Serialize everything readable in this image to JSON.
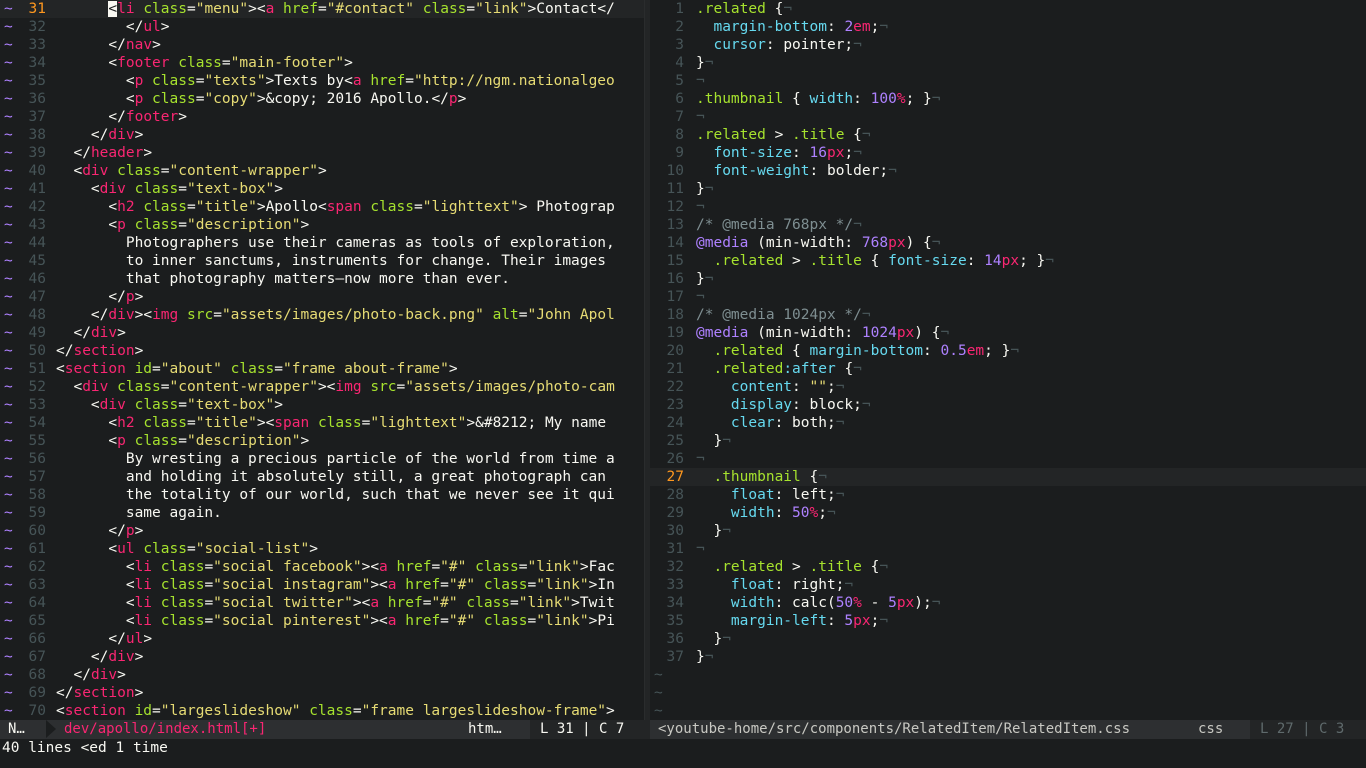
{
  "left_pane": {
    "lines": [
      {
        "n": "31",
        "t": "      <li class=\"menu\"><a href=\"#contact\" class=\"link\">Contact</"
      },
      {
        "n": "32",
        "t": "        </ul>"
      },
      {
        "n": "33",
        "t": "      </nav>"
      },
      {
        "n": "34",
        "t": "      <footer class=\"main-footer\">"
      },
      {
        "n": "35",
        "t": "        <p class=\"texts\">Texts by<a href=\"http://ngm.nationalgeo"
      },
      {
        "n": "36",
        "t": "        <p class=\"copy\">&copy; 2016 Apollo.</p>"
      },
      {
        "n": "37",
        "t": "      </footer>"
      },
      {
        "n": "38",
        "t": "    </div>"
      },
      {
        "n": "39",
        "t": "  </header>"
      },
      {
        "n": "40",
        "t": "  <div class=\"content-wrapper\">"
      },
      {
        "n": "41",
        "t": "    <div class=\"text-box\">"
      },
      {
        "n": "42",
        "t": "      <h2 class=\"title\">Apollo<span class=\"lighttext\"> Photograp"
      },
      {
        "n": "43",
        "t": "      <p class=\"description\">"
      },
      {
        "n": "44",
        "t": "        Photographers use their cameras as tools of exploration,"
      },
      {
        "n": "45",
        "t": "        to inner sanctums, instruments for change. Their images"
      },
      {
        "n": "46",
        "t": "        that photography matters—now more than ever."
      },
      {
        "n": "47",
        "t": "      </p>"
      },
      {
        "n": "48",
        "t": "    </div><img src=\"assets/images/photo-back.png\" alt=\"John Apol"
      },
      {
        "n": "49",
        "t": "  </div>"
      },
      {
        "n": "50",
        "t": "</section>"
      },
      {
        "n": "51",
        "t": "<section id=\"about\" class=\"frame about-frame\">"
      },
      {
        "n": "52",
        "t": "  <div class=\"content-wrapper\"><img src=\"assets/images/photo-cam"
      },
      {
        "n": "53",
        "t": "    <div class=\"text-box\">"
      },
      {
        "n": "54",
        "t": "      <h2 class=\"title\"><span class=\"lighttext\">&#8212; My name"
      },
      {
        "n": "55",
        "t": "      <p class=\"description\">"
      },
      {
        "n": "56",
        "t": "        By wresting a precious particle of the world from time a"
      },
      {
        "n": "57",
        "t": "        and holding it absolutely still, a great photograph can"
      },
      {
        "n": "58",
        "t": "        the totality of our world, such that we never see it qui"
      },
      {
        "n": "59",
        "t": "        same again."
      },
      {
        "n": "60",
        "t": "      </p>"
      },
      {
        "n": "61",
        "t": "      <ul class=\"social-list\">"
      },
      {
        "n": "62",
        "t": "        <li class=\"social facebook\"><a href=\"#\" class=\"link\">Fac"
      },
      {
        "n": "63",
        "t": "        <li class=\"social instagram\"><a href=\"#\" class=\"link\">In"
      },
      {
        "n": "64",
        "t": "        <li class=\"social twitter\"><a href=\"#\" class=\"link\">Twit"
      },
      {
        "n": "65",
        "t": "        <li class=\"social pinterest\"><a href=\"#\" class=\"link\">Pi"
      },
      {
        "n": "66",
        "t": "      </ul>"
      },
      {
        "n": "67",
        "t": "    </div>"
      },
      {
        "n": "68",
        "t": "  </div>"
      },
      {
        "n": "69",
        "t": "</section>"
      },
      {
        "n": "70",
        "t": "<section id=\"largeslideshow\" class=\"frame largeslideshow-frame\">"
      }
    ]
  },
  "right_pane": {
    "lines": [
      {
        "n": "1",
        "t": ".related {¬"
      },
      {
        "n": "2",
        "t": "  margin-bottom: 2em;¬"
      },
      {
        "n": "3",
        "t": "  cursor: pointer;¬"
      },
      {
        "n": "4",
        "t": "}¬"
      },
      {
        "n": "5",
        "t": "¬"
      },
      {
        "n": "6",
        "t": ".thumbnail { width: 100%; }¬"
      },
      {
        "n": "7",
        "t": "¬"
      },
      {
        "n": "8",
        "t": ".related > .title {¬"
      },
      {
        "n": "9",
        "t": "  font-size: 16px;¬"
      },
      {
        "n": "10",
        "t": "  font-weight: bolder;¬"
      },
      {
        "n": "11",
        "t": "}¬"
      },
      {
        "n": "12",
        "t": "¬"
      },
      {
        "n": "13",
        "t": "/* @media 768px */¬"
      },
      {
        "n": "14",
        "t": "@media (min-width: 768px) {¬"
      },
      {
        "n": "15",
        "t": "  .related > .title { font-size: 14px; }¬"
      },
      {
        "n": "16",
        "t": "}¬"
      },
      {
        "n": "17",
        "t": "¬"
      },
      {
        "n": "18",
        "t": "/* @media 1024px */¬"
      },
      {
        "n": "19",
        "t": "@media (min-width: 1024px) {¬"
      },
      {
        "n": "20",
        "t": "  .related { margin-bottom: 0.5em; }¬"
      },
      {
        "n": "21",
        "t": "  .related:after {¬"
      },
      {
        "n": "22",
        "t": "    content: \"\";¬"
      },
      {
        "n": "23",
        "t": "    display: block;¬"
      },
      {
        "n": "24",
        "t": "    clear: both;¬"
      },
      {
        "n": "25",
        "t": "  }¬"
      },
      {
        "n": "26",
        "t": "¬"
      },
      {
        "n": "27",
        "t": "  .thumbnail {¬"
      },
      {
        "n": "28",
        "t": "    float: left;¬"
      },
      {
        "n": "29",
        "t": "    width: 50%;¬"
      },
      {
        "n": "30",
        "t": "  }¬"
      },
      {
        "n": "31",
        "t": "¬"
      },
      {
        "n": "32",
        "t": "  .related > .title {¬"
      },
      {
        "n": "33",
        "t": "    float: right;¬"
      },
      {
        "n": "34",
        "t": "    width: calc(50% - 5px);¬"
      },
      {
        "n": "35",
        "t": "    margin-left: 5px;¬"
      },
      {
        "n": "36",
        "t": "  }¬"
      },
      {
        "n": "37",
        "t": "}¬"
      }
    ],
    "empty_markers": [
      "~",
      "~",
      "~"
    ]
  },
  "statusbar": {
    "mode": "N…",
    "left_file": "dev/apollo/index.html[+]",
    "left_filetype": "htm…",
    "left_position": "L 31 | C 7",
    "right_file": "<youtube-home/src/components/RelatedItem/RelatedItem.css",
    "right_filetype": "css",
    "right_position": "L 27 | C 3"
  },
  "cmdline": "40 lines <ed 1 time",
  "colors": {
    "background": "#1b1d1e",
    "tag": "#f92672",
    "attribute": "#a6e22e",
    "string": "#e6db74",
    "keyword": "#66d9ef",
    "number": "#ae81ff",
    "comment": "#7e8e91"
  }
}
